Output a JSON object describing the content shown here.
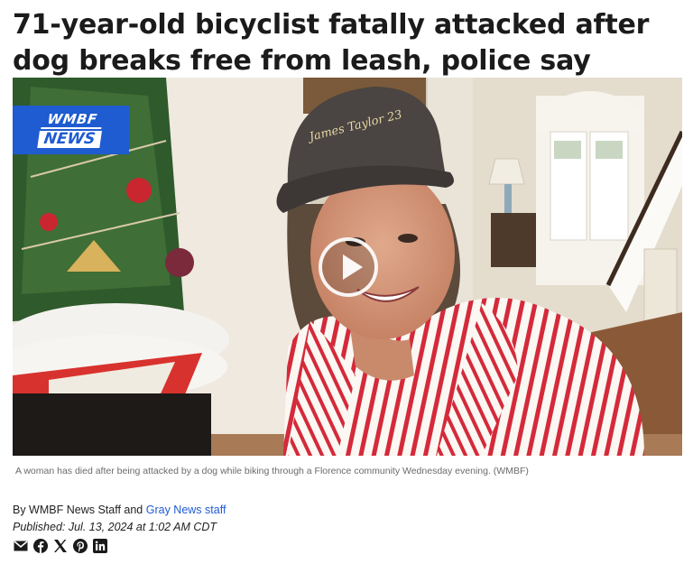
{
  "article": {
    "headline": "71-year-old bicyclist fatally attacked after dog breaks free from leash, police say",
    "caption": "A woman has died after being attacked by a dog while biking through a Florence community Wednesday evening. (WMBF)",
    "byline_prefix": "By WMBF News Staff and ",
    "byline_link": "Gray News staff",
    "published": "Published: Jul. 13, 2024 at 1:02 AM CDT"
  },
  "media": {
    "logo_top": "WMBF",
    "logo_bottom": "NEWS",
    "hat_text": "James Taylor 23",
    "play_icon": "play-icon"
  },
  "share": {
    "icons": [
      "email-icon",
      "facebook-icon",
      "x-icon",
      "pinterest-icon",
      "linkedin-icon"
    ]
  },
  "colors": {
    "brand_blue": "#1f5bd1",
    "link_blue": "#1f5bd1",
    "caption_gray": "#6b6b6b",
    "stripe_red": "#d42a3a"
  }
}
